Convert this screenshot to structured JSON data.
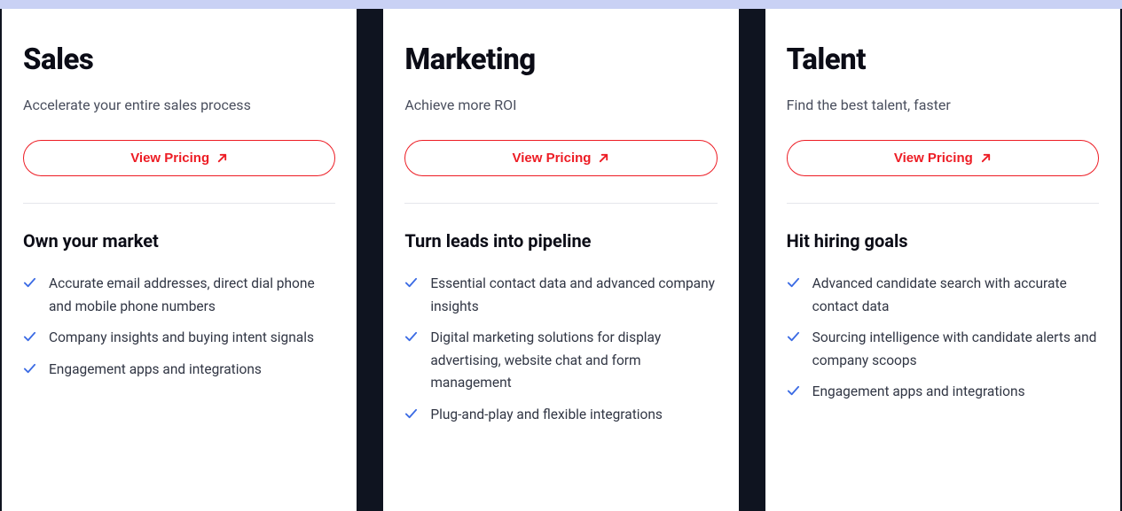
{
  "cards": [
    {
      "title": "Sales",
      "subtitle": "Accelerate your entire sales process",
      "cta": "View Pricing",
      "section": "Own your market",
      "features": [
        "Accurate email addresses, direct dial phone and mobile phone numbers",
        "Company insights and buying intent signals",
        "Engagement apps and integrations"
      ]
    },
    {
      "title": "Marketing",
      "subtitle": "Achieve more ROI",
      "cta": "View Pricing",
      "section": "Turn leads into pipeline",
      "features": [
        "Essential contact data and advanced company insights",
        "Digital marketing solutions for display advertising, website chat and form management",
        "Plug-and-play and flexible integrations"
      ]
    },
    {
      "title": "Talent",
      "subtitle": "Find the best talent, faster",
      "cta": "View Pricing",
      "section": "Hit hiring goals",
      "features": [
        "Advanced candidate search with accurate contact data",
        "Sourcing intelligence with candidate alerts and company scoops",
        "Engagement apps and integrations"
      ]
    }
  ],
  "colors": {
    "accent": "#ed1c24",
    "check": "#3b6be4"
  }
}
